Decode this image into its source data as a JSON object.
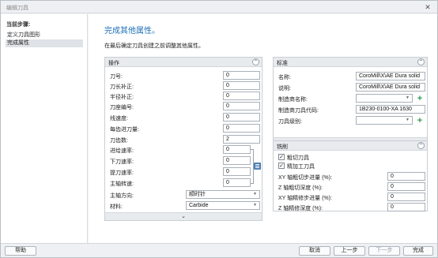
{
  "window": {
    "title": "编辑刀具"
  },
  "sidebar": {
    "heading": "当前步骤:",
    "steps": [
      {
        "label": "定义刀具图形"
      },
      {
        "label": "完成属性"
      }
    ]
  },
  "main": {
    "title": "完成其他属性。",
    "subtitle": "在最后确定刀具创建之前调整其他属性。"
  },
  "operations": {
    "title": "操作",
    "fields": [
      {
        "label": "刀号:",
        "value": "0"
      },
      {
        "label": "刀长补正:",
        "value": "0"
      },
      {
        "label": "半径补正:",
        "value": "0"
      },
      {
        "label": "刀座编号:",
        "value": "0"
      },
      {
        "label": "线速度:",
        "value": "0"
      },
      {
        "label": "每齿进刀量:",
        "value": "0"
      },
      {
        "label": "刀齿数:",
        "value": "2"
      },
      {
        "label": "进给速率:",
        "value": "0"
      },
      {
        "label": "下刀速率:",
        "value": "0"
      },
      {
        "label": "提刀速率:",
        "value": "0"
      },
      {
        "label": "主轴转速:",
        "value": "0"
      }
    ],
    "spindle_direction": {
      "label": "主轴方向:",
      "value": "顺时针"
    },
    "material": {
      "label": "材料:",
      "value": "Carbide"
    }
  },
  "standard": {
    "title": "标准",
    "name": {
      "label": "名称:",
      "value": "CoroMill\\X\\AE Dura solid"
    },
    "description": {
      "label": "说明:",
      "value": "CoroMill\\X\\AE Dura solid"
    },
    "manufacturer": {
      "label": "制造商名称:",
      "value": ""
    },
    "manufacturer_code": {
      "label": "制造商刀具代码:",
      "value": "1B230-0100-XA    1630"
    },
    "tool_grade": {
      "label": "刀具级别:",
      "value": ""
    }
  },
  "milling": {
    "title": "铣削",
    "checkboxes": [
      {
        "label": "粗切刀具",
        "checked": true
      },
      {
        "label": "精加工刀具",
        "checked": true
      }
    ],
    "fields": [
      {
        "label": "XY 轴粗切步进量 (%):",
        "value": "0"
      },
      {
        "label": "Z 轴粗切深度 (%):",
        "value": "0"
      },
      {
        "label": "XY 轴精修步进量 (%):",
        "value": "0"
      },
      {
        "label": "Z 轴精修深度 (%):",
        "value": "0"
      }
    ]
  },
  "icons": {
    "collapse": "⌃",
    "expand": "⌄",
    "dropdown": "▼",
    "close": "✕",
    "check": "✓",
    "plus": "+"
  },
  "buttons": {
    "help": "帮助",
    "cancel": "取消",
    "previous": "上一步",
    "next": "下一步",
    "finish": "完成"
  },
  "colors": {
    "title_blue": "#1f6fb5",
    "plus_green": "#2e9b4e"
  }
}
